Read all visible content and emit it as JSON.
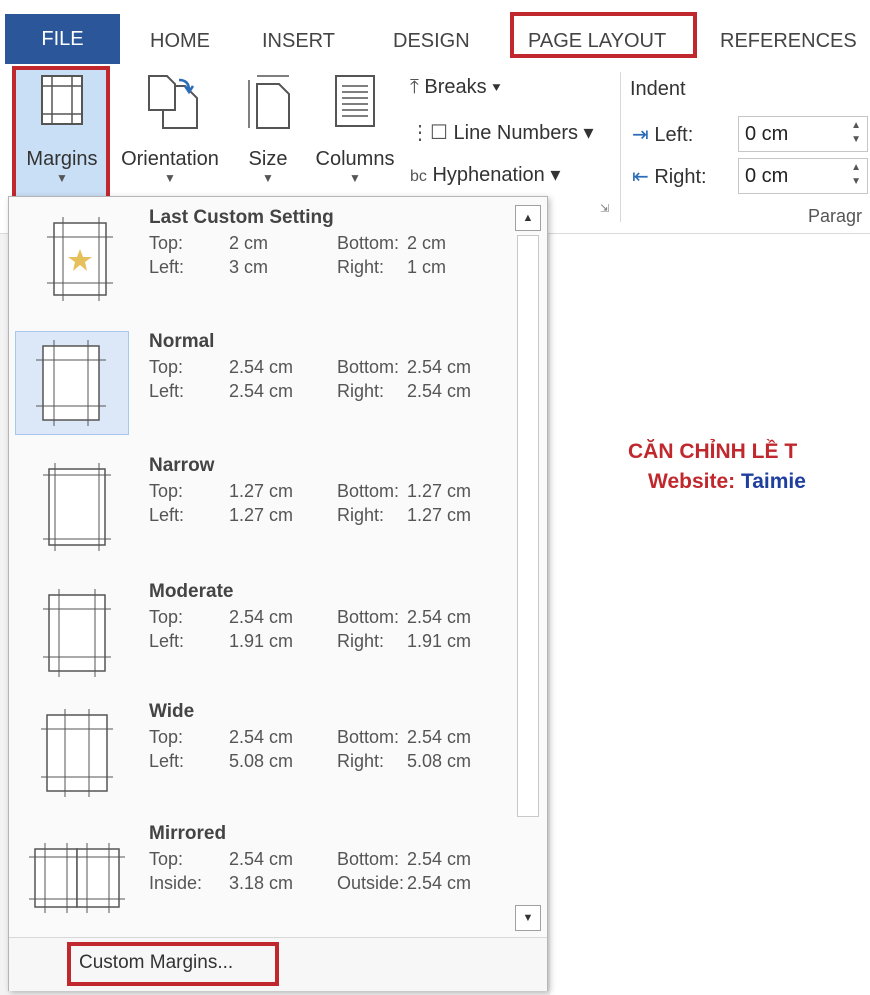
{
  "tabs": [
    "FILE",
    "HOME",
    "INSERT",
    "DESIGN",
    "PAGE LAYOUT",
    "REFERENCES"
  ],
  "ribbon": {
    "margins_label": "Margins",
    "orientation_label": "Orientation",
    "size_label": "Size",
    "columns_label": "Columns",
    "breaks_label": "Breaks ▾",
    "line_numbers_label": "Line Numbers ▾",
    "hyphenation_label": "Hyphenation ▾",
    "indent_label": "Indent",
    "left_label": "Left:",
    "right_label": "Right:",
    "left_value": "0 cm",
    "right_value": "0 cm",
    "group_label": "Paragr"
  },
  "menu": {
    "items": [
      {
        "name": "Last Custom Setting",
        "r1l": "Top:",
        "r1v": "2 cm",
        "r1l2": "Bottom:",
        "r1v2": "2 cm",
        "r2l": "Left:",
        "r2v": "3 cm",
        "r2l2": "Right:",
        "r2v2": "1 cm"
      },
      {
        "name": "Normal",
        "r1l": "Top:",
        "r1v": "2.54 cm",
        "r1l2": "Bottom:",
        "r1v2": "2.54 cm",
        "r2l": "Left:",
        "r2v": "2.54 cm",
        "r2l2": "Right:",
        "r2v2": "2.54 cm"
      },
      {
        "name": "Narrow",
        "r1l": "Top:",
        "r1v": "1.27 cm",
        "r1l2": "Bottom:",
        "r1v2": "1.27 cm",
        "r2l": "Left:",
        "r2v": "1.27 cm",
        "r2l2": "Right:",
        "r2v2": "1.27 cm"
      },
      {
        "name": "Moderate",
        "r1l": "Top:",
        "r1v": "2.54 cm",
        "r1l2": "Bottom:",
        "r1v2": "2.54 cm",
        "r2l": "Left:",
        "r2v": "1.91 cm",
        "r2l2": "Right:",
        "r2v2": "1.91 cm"
      },
      {
        "name": "Wide",
        "r1l": "Top:",
        "r1v": "2.54 cm",
        "r1l2": "Bottom:",
        "r1v2": "2.54 cm",
        "r2l": "Left:",
        "r2v": "5.08 cm",
        "r2l2": "Right:",
        "r2v2": "5.08 cm"
      },
      {
        "name": "Mirrored",
        "r1l": "Top:",
        "r1v": "2.54 cm",
        "r1l2": "Bottom:",
        "r1v2": "2.54 cm",
        "r2l": "Inside:",
        "r2v": "3.18 cm",
        "r2l2": "Outside:",
        "r2v2": "2.54 cm"
      }
    ],
    "custom_margins": "Custom Margins..."
  },
  "document": {
    "line1": "CĂN CHỈNH LỀ T",
    "line2_prefix": "Website: ",
    "line2_link": "Taimie"
  },
  "colors": {
    "file_tab": "#2b579a",
    "highlight_red": "#c0282d",
    "doc_title_red": "#c0282d",
    "doc_link_blue": "#1f3f9f",
    "selected_item": "#dce8f7",
    "star": "#e6c15a"
  }
}
